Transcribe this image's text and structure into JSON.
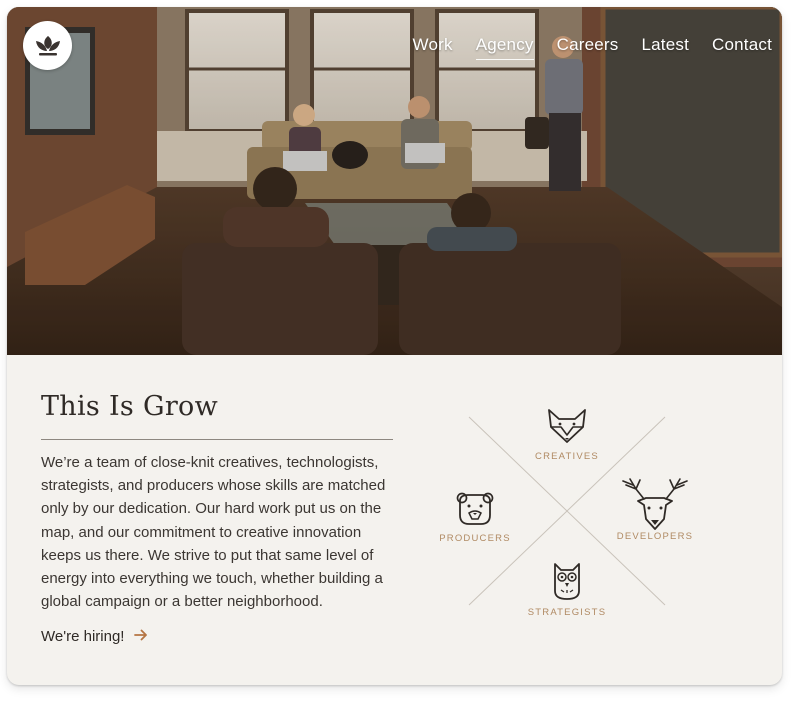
{
  "nav": {
    "items": [
      {
        "label": "Work",
        "active": false
      },
      {
        "label": "Agency",
        "active": true
      },
      {
        "label": "Careers",
        "active": false
      },
      {
        "label": "Latest",
        "active": false
      },
      {
        "label": "Contact",
        "active": false
      }
    ]
  },
  "hero": {
    "logo_icon": "sprout-leaf-icon"
  },
  "intro": {
    "title": "This Is Grow",
    "body": "We’re a team of close-knit creatives, technologists, strategists, and producers whose skills are matched only by our dedication. Our hard work put us on the map, and our commitment to creative innovation keeps us there. We strive to put that same level of energy into everything we touch, whether building a global campaign or a better neighborhood.",
    "hiring_label": "We're hiring!",
    "hiring_icon": "arrow-right-icon"
  },
  "diagram": {
    "roles": [
      {
        "label": "CREATIVES",
        "icon": "fox-icon"
      },
      {
        "label": "PRODUCERS",
        "icon": "bear-icon"
      },
      {
        "label": "DEVELOPERS",
        "icon": "deer-icon"
      },
      {
        "label": "STRATEGISTS",
        "icon": "owl-icon"
      }
    ]
  },
  "colors": {
    "accent": "#b57543",
    "role_label": "#b08a63",
    "background": "#f4f2ee",
    "text": "#3b3632"
  }
}
